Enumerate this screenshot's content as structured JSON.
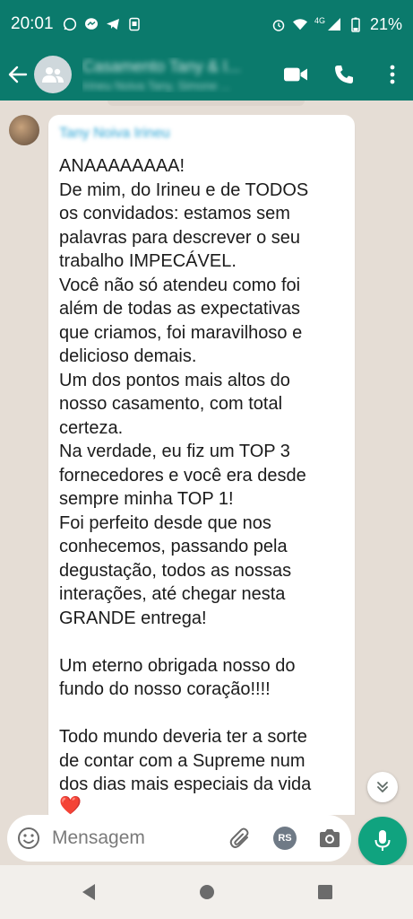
{
  "status_bar": {
    "time": "20:01",
    "network": "4G",
    "battery": "21%"
  },
  "chat": {
    "title": "Casamento Tany & I...",
    "subtitle": "Irineu Noiva Tany, Simone ..."
  },
  "message": {
    "sender": "Tany Noiva Irineu",
    "lines": [
      "ANAAAAAAAA!",
      "De mim, do Irineu e de TODOS",
      "os convidados: estamos sem",
      "palavras para descrever o seu",
      "trabalho IMPECÁVEL.",
      "Você não só atendeu como foi",
      "além de todas as expectativas",
      "que criamos, foi maravilhoso e",
      "delicioso demais.",
      "Um dos pontos mais altos do",
      "nosso casamento, com total",
      "certeza.",
      "Na verdade, eu fiz um TOP 3",
      "fornecedores e você era desde",
      "sempre minha TOP 1!",
      "Foi perfeito desde que nos",
      "conhecemos, passando pela",
      "degustação, todos as nossas",
      "interações, até chegar nesta",
      "GRANDE entrega!",
      "",
      "Um eterno obrigada nosso do",
      "fundo do nosso coração!!!!",
      "",
      "Todo mundo deveria ter a sorte",
      "de contar com a Supreme num",
      "dos dias mais especiais da vida"
    ],
    "heart": "❤️"
  },
  "composer": {
    "placeholder": "Mensagem",
    "rs_badge": "RS"
  },
  "colors": {
    "header": "#0b7a6c",
    "mic": "#10a37f",
    "chat_bg": "#e5ddd5"
  }
}
